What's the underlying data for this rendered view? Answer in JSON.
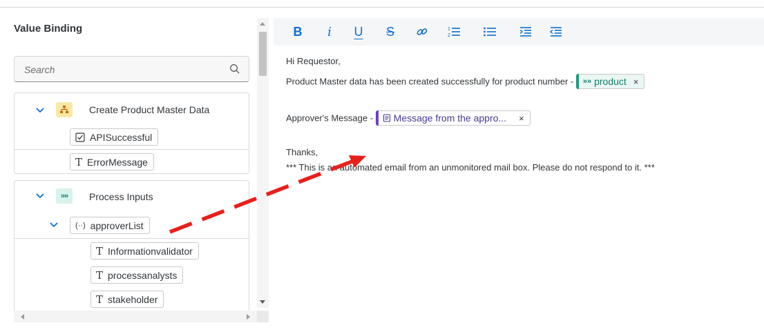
{
  "value_binding": {
    "title": "Value Binding",
    "search": {
      "placeholder": "Search",
      "value": ""
    },
    "groups": [
      {
        "label": "Create Product Master Data",
        "icon": "hierarchy-icon",
        "items": [
          {
            "type_icon": "checkbox-icon",
            "label": "APISuccessful"
          },
          {
            "type_glyph": "T",
            "label": "ErrorMessage"
          }
        ]
      },
      {
        "label": "Process Inputs",
        "icon_text": "»»",
        "items": [
          {
            "type_glyph": "(··)",
            "label": "approverList"
          },
          {
            "type_glyph": "T",
            "label": "Informationvalidator"
          },
          {
            "type_glyph": "T",
            "label": "processanalysts"
          },
          {
            "type_glyph": "T",
            "label": "stakeholder"
          }
        ]
      }
    ]
  },
  "toolbar": {
    "buttons": [
      "bold-button",
      "italic-button",
      "underline-button",
      "strikethrough-button",
      "link-button",
      "ordered-list-button",
      "unordered-list-button",
      "indent-button",
      "outdent-button"
    ],
    "bold": "B",
    "italic": "i",
    "underline": "U",
    "strike": "S"
  },
  "editor": {
    "greeting": "Hi Requestor,",
    "line2_prefix": "Product Master data has been created successfully for product number - ",
    "token_product": {
      "icon": "»»",
      "label": "product",
      "close": "×"
    },
    "line3_prefix": "Approver's Message - ",
    "token_message": {
      "label": "Message from the appro...",
      "close": "×"
    },
    "thanks": "Thanks,",
    "footer": "*** This is an automated email from an unmonitored mail box. Please do not respond to it. ***"
  },
  "colors": {
    "accent": "#0a6ed1",
    "teal": "#1d9a7f",
    "purple": "#6c3fc9",
    "arrow": "#e8201a"
  }
}
